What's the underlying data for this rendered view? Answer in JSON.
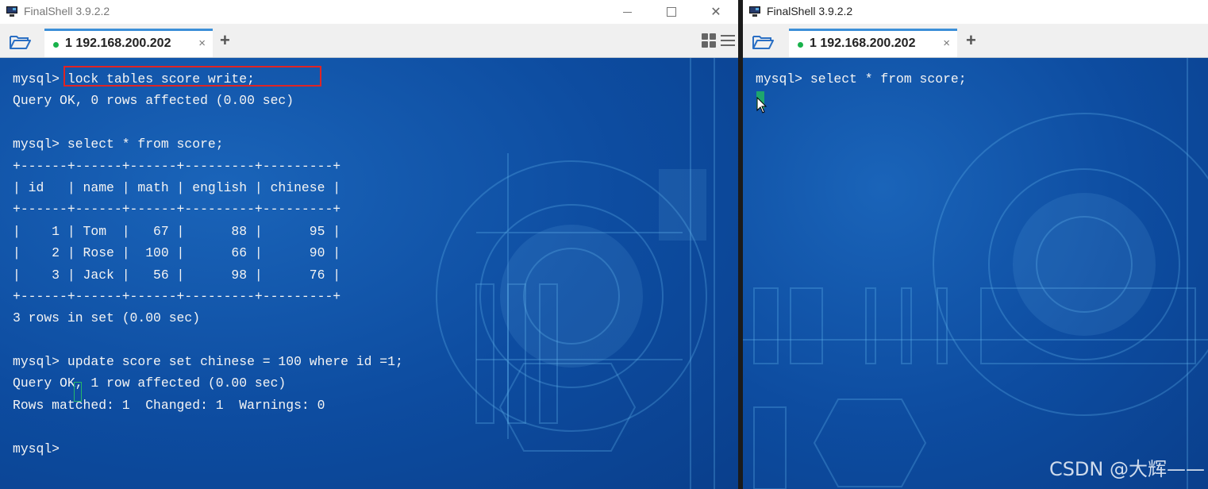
{
  "windows": [
    {
      "title": "FinalShell 3.9.2.2",
      "tab_label": "1 192.168.200.202",
      "tab_close": "×",
      "add_tab": "+",
      "lines": [
        "mysql> lock tables score write;",
        "Query OK, 0 rows affected (0.00 sec)",
        "",
        "mysql> select * from score;",
        "+------+------+------+---------+---------+",
        "| id   | name | math | english | chinese |",
        "+------+------+------+---------+---------+",
        "|    1 | Tom  |   67 |      88 |      95 |",
        "|    2 | Rose |  100 |      66 |      90 |",
        "|    3 | Jack |   56 |      98 |      76 |",
        "+------+------+------+---------+---------+",
        "3 rows in set (0.00 sec)",
        "",
        "mysql> update score set chinese = 100 where id =1;",
        "Query OK, 1 row affected (0.00 sec)",
        "Rows matched: 1  Changed: 1  Warnings: 0",
        "",
        "mysql> "
      ]
    },
    {
      "title": "FinalShell 3.9.2.2",
      "tab_label": "1 192.168.200.202",
      "tab_close": "×",
      "add_tab": "+",
      "lines": [
        "mysql> select * from score;"
      ]
    }
  ],
  "window_controls": {
    "close": "✕"
  },
  "watermark": "CSDN @大辉——",
  "colors": {
    "terminal_bg": "#0d4ca0",
    "terminal_text": "#f4f4f4",
    "highlight_box": "#e02424",
    "tab_accent": "#3c8fd8",
    "status_dot": "#19b24b",
    "cursor": "#1ea66d"
  },
  "icons": [
    "app-icon",
    "folder-open-icon",
    "layout-grid-icon",
    "menu-icon",
    "minimize-icon",
    "maximize-icon",
    "close-icon",
    "mouse-pointer-icon"
  ]
}
